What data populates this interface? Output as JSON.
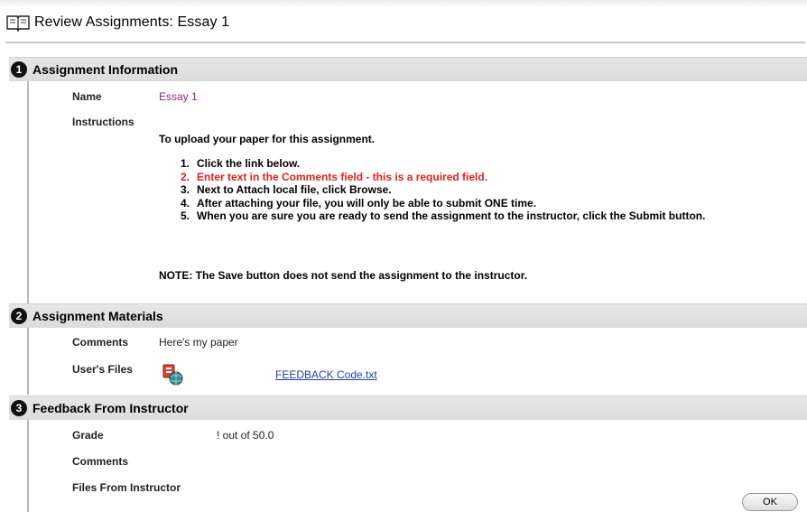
{
  "header": {
    "title": "Review Assignments: Essay 1",
    "icon": "book-icon"
  },
  "sections": {
    "info": {
      "number": "1",
      "title": "Assignment Information",
      "name_label": "Name",
      "name_value": "Essay 1",
      "instructions_label": "Instructions",
      "intro": "To upload your paper for this assignment.",
      "steps": [
        {
          "num": "1.",
          "text": "Click the link below."
        },
        {
          "num": "2.",
          "text": "Enter text in the Comments field - this is a required field."
        },
        {
          "num": "3.",
          "text": "Next to Attach local file, click Browse."
        },
        {
          "num": "4.",
          "text": "After attaching your file, you will only be able to submit ONE time."
        },
        {
          "num": "5.",
          "text": "When you are sure you are ready to send the assignment to the instructor, click the Submit button."
        }
      ],
      "note": "NOTE: The Save button does not send the assignment to the instructor."
    },
    "materials": {
      "number": "2",
      "title": "Assignment Materials",
      "comments_label": "Comments",
      "comments_value": "Here's my paper",
      "files_label": "User's Files",
      "file_name": "FEEDBACK Code.txt",
      "file_icon": "file-attachment-icon"
    },
    "feedback": {
      "number": "3",
      "title": "Feedback From Instructor",
      "grade_label": "Grade",
      "grade_value": "! out of 50.0",
      "comments_label": "Comments",
      "files_label": "Files From Instructor"
    }
  },
  "buttons": {
    "ok_label": "OK"
  },
  "colors": {
    "required": "#e0201a",
    "essay_name": "#8a2a8a",
    "link": "#1f3ea8"
  }
}
